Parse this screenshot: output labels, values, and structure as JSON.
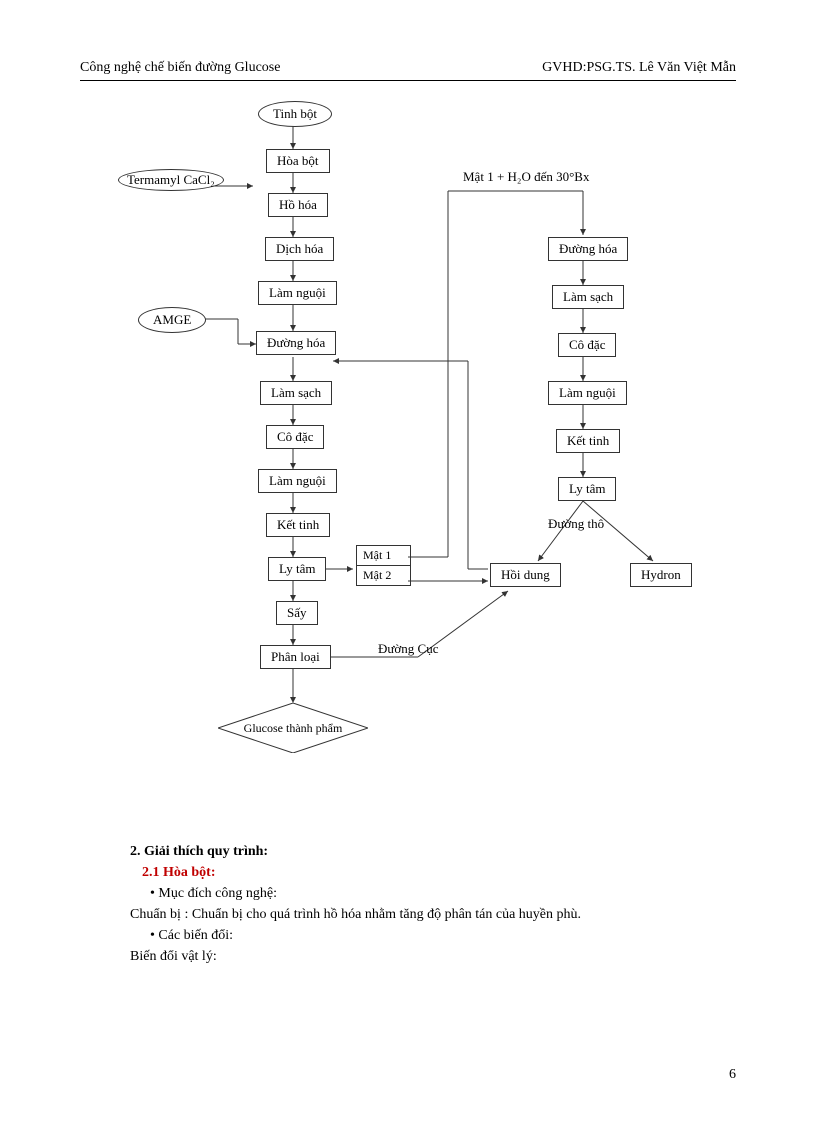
{
  "header": {
    "left": "Công nghệ chế biến đường Glucose",
    "right": "GVHD:PSG.TS. Lê Văn Việt Mẫn"
  },
  "diagram": {
    "nodes": {
      "tinhbot": "Tinh bột",
      "hoabot": "Hòa bột",
      "termamyl": "Termamyl CaCl₂",
      "hohoa": "Hồ hóa",
      "dichhoa": "Dịch hóa",
      "lamnguoi1": "Làm nguội",
      "amge": "AMGE",
      "duonghoa1": "Đường hóa",
      "lamsach1": "Làm sạch",
      "codac1": "Cô đặc",
      "lamnguoi2": "Làm nguội",
      "kettinh1": "Kết tinh",
      "lytam1": "Ly tâm",
      "say": "Sấy",
      "phanloai": "Phân loại",
      "glucose": "Glucose thành phẩm",
      "mat1": "Mật 1",
      "mat2": "Mật 2",
      "mat_h2o": "Mật 1 + H₂O đến 30°Bx",
      "duonghoa2": "Đường hóa",
      "lamsach2": "Làm sạch",
      "codac2": "Cô đặc",
      "lamnguoi3": "Làm nguội",
      "kettinh2": "Kết tinh",
      "lytam2": "Ly tâm",
      "duongtho": "Đường thô",
      "hoidung": "Hồi dung",
      "hydron": "Hydron",
      "duongcuc": "Đường Cục"
    }
  },
  "content": {
    "section_num": "2.",
    "section_title": "Giải thích quy trình:",
    "sub_num": "2.1",
    "sub_title": "Hòa bột:",
    "bullet1": "Mục đích công nghệ:",
    "line1": "Chuẩn bị : Chuẩn bị cho quá trình hồ hóa nhằm tăng độ phân tán của huyền phù.",
    "bullet2": "Các biến đổi:",
    "line2": "Biến đổi vật lý:"
  },
  "page_number": "6"
}
